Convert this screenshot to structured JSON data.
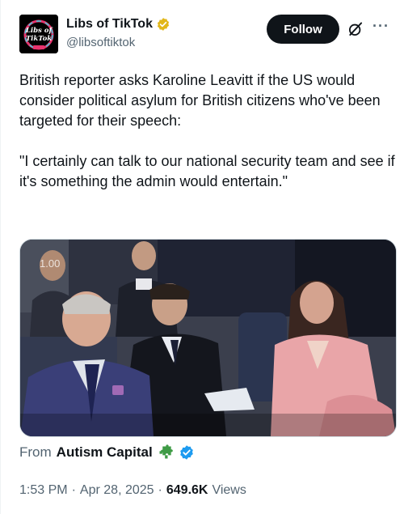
{
  "author": {
    "display_name": "Libs of TikTok",
    "handle": "@libsoftiktok",
    "avatar_text_top": "Libs of",
    "avatar_text_bottom": "TikTok"
  },
  "actions": {
    "follow_label": "Follow",
    "more_label": "···"
  },
  "tweet": {
    "paragraphs": [
      "British reporter asks Karoline Leavitt if the US would consider political asylum for British citizens who've been targeted for their speech:",
      "\"I certainly can talk to our national security team and see if it's something the admin would entertain.\""
    ]
  },
  "media": {
    "playback_rate": "1.00"
  },
  "attribution": {
    "prefix": "From",
    "source": "Autism Capital"
  },
  "meta": {
    "time": "1:53 PM",
    "separator": "·",
    "date": "Apr 28, 2025",
    "views_count": "649.6K",
    "views_label": "Views"
  },
  "colors": {
    "verified_gold": "#e2b719",
    "verified_blue": "#1d9bf0",
    "text_primary": "#0f1419",
    "text_secondary": "#536471",
    "puzzle_green": "#3e9b45"
  }
}
